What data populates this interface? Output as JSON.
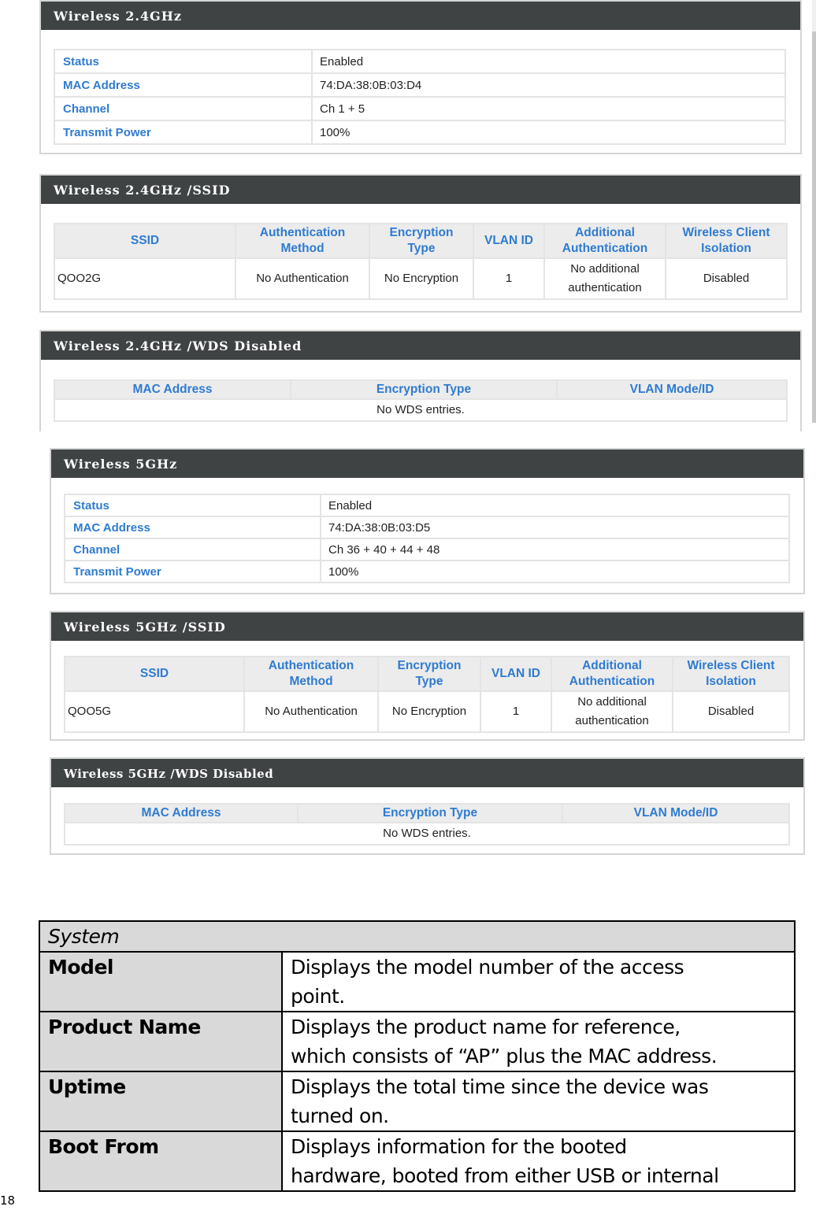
{
  "screenshots": [
    {
      "panels": [
        {
          "title": "Wireless 2.4GHz",
          "type": "kv",
          "rows": [
            {
              "label": "Status",
              "value": "Enabled"
            },
            {
              "label": "MAC Address",
              "value": "74:DA:38:0B:03:D4"
            },
            {
              "label": "Channel",
              "value": "Ch 1 + 5"
            },
            {
              "label": "Transmit Power",
              "value": "100%"
            }
          ]
        },
        {
          "title": "Wireless 2.4GHz /SSID",
          "type": "ssid",
          "headers": [
            {
              "l1": "SSID",
              "l2": ""
            },
            {
              "l1": "Authentication",
              "l2": "Method"
            },
            {
              "l1": "Encryption",
              "l2": "Type"
            },
            {
              "l1": "VLAN ID",
              "l2": ""
            },
            {
              "l1": "Additional",
              "l2": "Authentication"
            },
            {
              "l1": "Wireless Client",
              "l2": "Isolation"
            }
          ],
          "row": {
            "ssid": "QOO2G",
            "auth": "No Authentication",
            "enc": "No Encryption",
            "vlan": "1",
            "add_l1": "No additional",
            "add_l2": "authentication",
            "iso": "Disabled"
          }
        },
        {
          "title": "Wireless 2.4GHz /WDS Disabled",
          "type": "wds",
          "headers": [
            "MAC Address",
            "Encryption Type",
            "VLAN Mode/ID"
          ],
          "empty_message": "No WDS entries."
        }
      ]
    },
    {
      "panels": [
        {
          "title": "Wireless 5GHz",
          "type": "kv",
          "rows": [
            {
              "label": "Status",
              "value": "Enabled"
            },
            {
              "label": "MAC Address",
              "value": "74:DA:38:0B:03:D5"
            },
            {
              "label": "Channel",
              "value": "Ch 36 + 40 + 44 + 48"
            },
            {
              "label": "Transmit Power",
              "value": "100%"
            }
          ]
        },
        {
          "title": "Wireless 5GHz /SSID",
          "type": "ssid",
          "headers": [
            {
              "l1": "SSID",
              "l2": ""
            },
            {
              "l1": "Authentication",
              "l2": "Method"
            },
            {
              "l1": "Encryption",
              "l2": "Type"
            },
            {
              "l1": "VLAN ID",
              "l2": ""
            },
            {
              "l1": "Additional",
              "l2": "Authentication"
            },
            {
              "l1": "Wireless Client",
              "l2": "Isolation"
            }
          ],
          "row": {
            "ssid": "QOO5G",
            "auth": "No Authentication",
            "enc": "No Encryption",
            "vlan": "1",
            "add_l1": "No additional",
            "add_l2": "authentication",
            "iso": "Disabled"
          }
        },
        {
          "title": "Wireless 5GHz /WDS Disabled",
          "type": "wds",
          "headers": [
            "MAC Address",
            "Encryption Type",
            "VLAN Mode/ID"
          ],
          "empty_message": "No WDS entries."
        }
      ]
    }
  ],
  "doc_table": {
    "section": "System",
    "rows": [
      {
        "term": "Model",
        "desc_l1": "Displays the model number of the access",
        "desc_l2": "point."
      },
      {
        "term": "Product Name",
        "desc_l1": "Displays the product name for reference,",
        "desc_l2": "which consists of “AP” plus the MAC address."
      },
      {
        "term": "Uptime",
        "desc_l1": "Displays the total time since the device was",
        "desc_l2": "turned on."
      },
      {
        "term": "Boot From",
        "desc_l1": "Displays information for the booted",
        "desc_l2": "hardware, booted from either USB or internal"
      }
    ]
  },
  "page_number": "18",
  "colors": {
    "panel_header_bg": "#3f4344",
    "label_blue": "#2f7bd0",
    "table_header_bg": "#ececec",
    "doc_shade": "#d9d9d9"
  }
}
